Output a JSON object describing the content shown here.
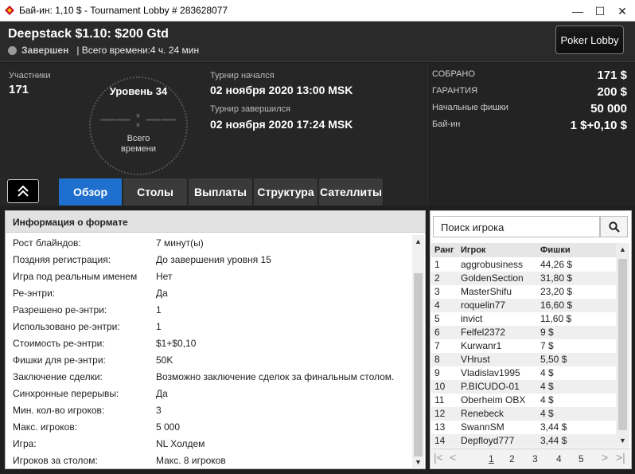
{
  "window": {
    "title": "Бай-ин: 1,10 $ - Tournament Lobby # 283628077",
    "minimize": "—",
    "maximize": "☐",
    "close": "✕"
  },
  "header": {
    "name": "Deepstack $1.10: $200 Gtd",
    "status": "Завершен",
    "total_time": "| Всего времени:4 ч. 24 мин",
    "lobby_button": "Poker Lobby"
  },
  "info": {
    "participants_label": "Участники",
    "participants_value": "171",
    "level": "Уровень 34",
    "clock": "––:––",
    "clock_sub1": "Всего",
    "clock_sub2": "времени",
    "started_label": "Турнир начался",
    "started_value": "02 ноября 2020  13:00 MSK",
    "ended_label": "Турнир завершился",
    "ended_value": "02 ноября 2020  17:24 MSK"
  },
  "prize": [
    {
      "label": "СОБРАНО",
      "value": "171 $"
    },
    {
      "label": "ГАРАНТИЯ",
      "value": "200 $"
    },
    {
      "label": "Начальные фишки",
      "value": "50 000"
    },
    {
      "label": "Бай-ин",
      "value": "1 $+0,10 $"
    }
  ],
  "tabs": [
    "Обзор",
    "Столы",
    "Выплаты",
    "Структура",
    "Сателлиты"
  ],
  "format": {
    "title": "Информация о формате",
    "rows": [
      {
        "k": "Рост блайндов:",
        "v": "7 минут(ы)"
      },
      {
        "k": "Поздняя регистрация:",
        "v": "До завершения уровня 15"
      },
      {
        "k": "Игра под реальным именем",
        "v": "Нет"
      },
      {
        "k": "Ре-энтри:",
        "v": "Да"
      },
      {
        "k": "Разрешено ре-энтри:",
        "v": "1"
      },
      {
        "k": "Использовано ре-энтри:",
        "v": "1"
      },
      {
        "k": "Стоимость ре-энтри:",
        "v": "$1+$0,10"
      },
      {
        "k": "Фишки для ре-энтри:",
        "v": "50K"
      },
      {
        "k": "Заключение сделки:",
        "v": "Возможно заключение сделок за финальным столом."
      },
      {
        "k": "Синхронные перерывы:",
        "v": "Да"
      },
      {
        "k": "Мин. кол-во игроков:",
        "v": "3"
      },
      {
        "k": "Макс. игроков:",
        "v": "5 000"
      },
      {
        "k": "Игра:",
        "v": "NL Холдем"
      },
      {
        "k": "Игроков за столом:",
        "v": "Макс. 8 игроков"
      }
    ]
  },
  "players": {
    "search_placeholder": "Поиск игрока",
    "headers": {
      "rank": "Ранг",
      "player": "Игрок",
      "chips": "Фишки"
    },
    "rows": [
      {
        "rank": "1",
        "player": "aggrobusiness",
        "chips": "44,26 $"
      },
      {
        "rank": "2",
        "player": "GoldenSection",
        "chips": "31,80 $"
      },
      {
        "rank": "3",
        "player": "MasterShifu",
        "chips": "23,20 $"
      },
      {
        "rank": "4",
        "player": "roquelin77",
        "chips": "16,60 $"
      },
      {
        "rank": "5",
        "player": "invict",
        "chips": "11,60 $"
      },
      {
        "rank": "6",
        "player": "Felfel2372",
        "chips": "9 $"
      },
      {
        "rank": "7",
        "player": "Kurwanr1",
        "chips": "7 $"
      },
      {
        "rank": "8",
        "player": "VHrust",
        "chips": "5,50 $"
      },
      {
        "rank": "9",
        "player": "Vladislav1995",
        "chips": "4 $"
      },
      {
        "rank": "10",
        "player": "P.BICUDO-01",
        "chips": "4 $"
      },
      {
        "rank": "11",
        "player": "Oberheim OBX",
        "chips": "4 $"
      },
      {
        "rank": "12",
        "player": "Renebeck",
        "chips": "4 $"
      },
      {
        "rank": "13",
        "player": "SwannSM",
        "chips": "3,44 $"
      },
      {
        "rank": "14",
        "player": "Depfloyd777",
        "chips": "3,44 $"
      }
    ],
    "pages": [
      "1",
      "2",
      "3",
      "4",
      "5"
    ]
  }
}
